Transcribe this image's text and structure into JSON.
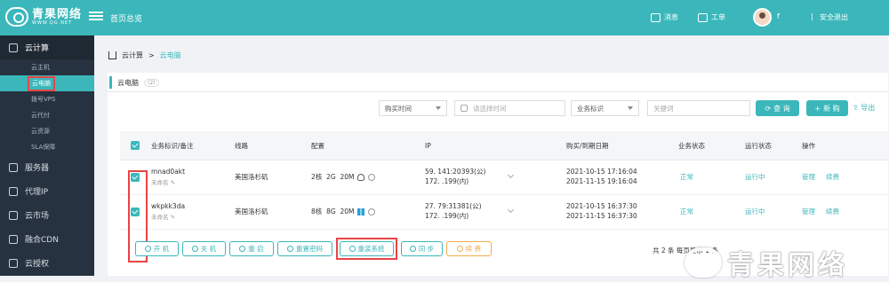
{
  "header": {
    "logo_text": "青果网络",
    "logo_sub": "WWW.QG.NET",
    "home_label": "首页总览",
    "messages_label": "消息",
    "tickets_label": "工单",
    "username": "f",
    "separator": "|",
    "logout_label": "安全退出"
  },
  "sidebar": {
    "main_label": "云计算",
    "sub_items": [
      "云主机",
      "云电脑",
      "拨号VPS",
      "云代付",
      "云资源",
      "SLA保障"
    ],
    "items": [
      "服务器",
      "代理IP",
      "云市场",
      "融合CDN",
      "云授权"
    ]
  },
  "breadcrumb": {
    "root": "云计算",
    "sep": ">",
    "current": "云电脑"
  },
  "tab": {
    "label": "云电脑",
    "count": "(2)"
  },
  "filters": {
    "purchase_time": "购买时间",
    "date_placeholder": "请选择时间",
    "biz_tag": "业务标识",
    "keyword_placeholder": "关键词",
    "query_label": "查 询",
    "new_label": "新 购",
    "export_label": "导出"
  },
  "table": {
    "headers": [
      "业务标识/备注",
      "线路",
      "配置",
      "IP",
      "购买/到期日期",
      "业务状态",
      "运行状态",
      "操作"
    ],
    "rows": [
      {
        "id": "mnad0akt",
        "note": "未命名",
        "line": "美国洛杉矶",
        "cores": "2核",
        "ram": "2G",
        "bw": "20M",
        "os": "linux",
        "ip1": "59.          141:20393(公)",
        "ip2": "172.          .199(内)",
        "date1": "2021-10-15 17:16:04",
        "date2": "2021-11-15 19:16:04",
        "biz_status": "正常",
        "run_status": "运行中",
        "manage": "管理",
        "renew": "续费"
      },
      {
        "id": "wkpkk3da",
        "note": "未命名",
        "line": "美国洛杉矶",
        "cores": "8核",
        "ram": "8G",
        "bw": "20M",
        "os": "windows",
        "ip1": "27.          79:31381(公)",
        "ip2": "172.          .199(内)",
        "date1": "2021-10-15 16:37:30",
        "date2": "2021-11-15 16:37:30",
        "biz_status": "正常",
        "run_status": "运行中",
        "manage": "管理",
        "renew": "续费"
      }
    ]
  },
  "actions": [
    "开 机",
    "关 机",
    "重 启",
    "重置密码",
    "重装系统",
    "同 步",
    "续 费"
  ],
  "pager": {
    "text": "共 2 条   每页显示   1 条"
  },
  "watermark": "青果网络",
  "colors": {
    "accent": "#3bb7bb",
    "sidebar": "#26323f",
    "highlight": "#e84545",
    "renew": "#f0ad4e"
  }
}
